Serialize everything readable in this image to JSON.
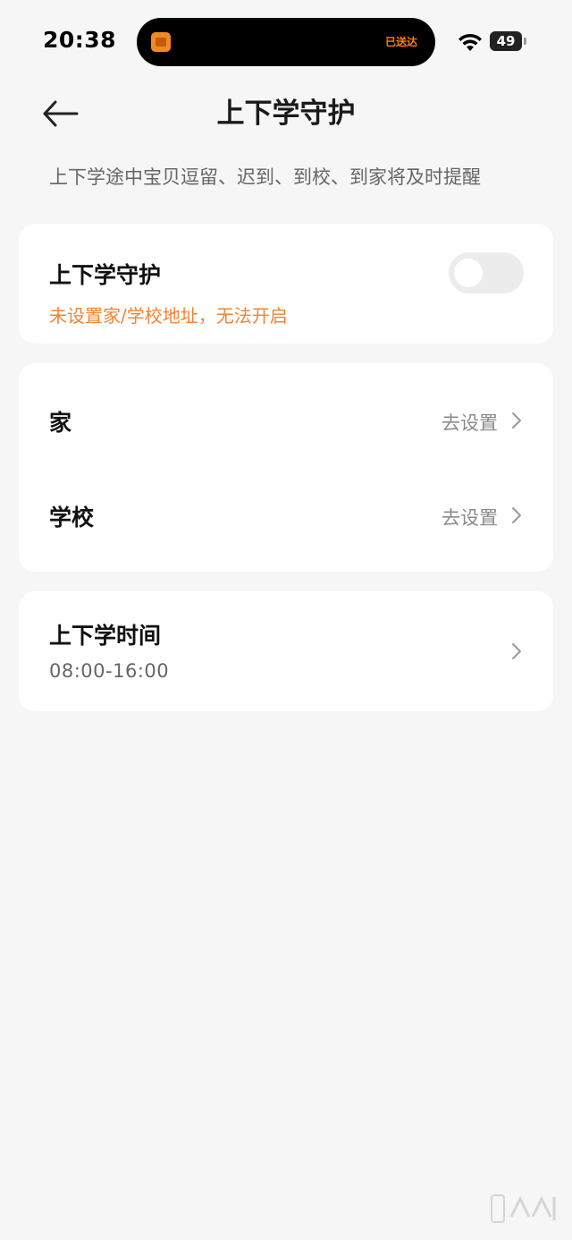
{
  "status_bar": {
    "time": "20:38",
    "island_text": "已送达",
    "battery_percent": "49",
    "battery_level": 0.49,
    "icons": [
      "wifi-icon",
      "battery-icon",
      "package-app-icon"
    ]
  },
  "header": {
    "title": "上下学守护",
    "back_icon": "arrow-left-icon"
  },
  "description": "上下学途中宝贝逗留、迟到、到校、到家将及时提醒",
  "guard_card": {
    "title": "上下学守护",
    "warning": "未设置家/学校地址，无法开启",
    "toggle_on": false
  },
  "address_card": {
    "rows": [
      {
        "label": "家",
        "action": "去设置"
      },
      {
        "label": "学校",
        "action": "去设置"
      }
    ]
  },
  "time_card": {
    "title": "上下学时间",
    "value": "08:00-16:00"
  },
  "colors": {
    "background": "#f6f6f6",
    "card": "#ffffff",
    "warning": "#f28432",
    "secondary_text": "#8a8a8a"
  }
}
